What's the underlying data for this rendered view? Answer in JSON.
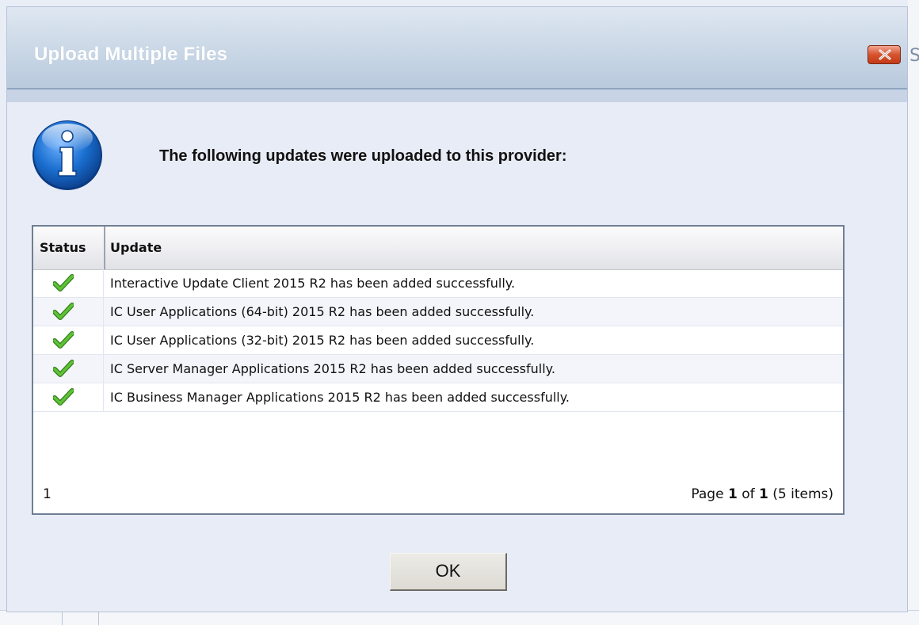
{
  "dialog": {
    "title": "Upload Multiple Files",
    "close_icon": "close-icon",
    "message": "The following updates were uploaded to this provider:",
    "info_icon": "info-icon",
    "ok_label": "OK"
  },
  "grid": {
    "columns": [
      "Status",
      "Update"
    ],
    "rows": [
      {
        "status": "success",
        "update": "Interactive Update Client 2015 R2 has been added successfully."
      },
      {
        "status": "success",
        "update": "IC User Applications (64-bit) 2015 R2 has been added successfully."
      },
      {
        "status": "success",
        "update": "IC User Applications (32-bit) 2015 R2 has been added successfully."
      },
      {
        "status": "success",
        "update": "IC Server Manager Applications 2015 R2 has been added successfully."
      },
      {
        "status": "success",
        "update": "IC Business Manager Applications 2015 R2 has been added successfully."
      }
    ],
    "pager": {
      "page_link": "1",
      "page_word": "Page",
      "current_page": "1",
      "of_word": "of",
      "total_pages": "1",
      "items_text": "(5 items)"
    }
  },
  "background": {
    "right_glyph": "S"
  },
  "colors": {
    "title_text": "#ffffff",
    "close_button": "#d6532e",
    "check_green": "#4caf2a",
    "info_blue": "#1a6fd0"
  }
}
